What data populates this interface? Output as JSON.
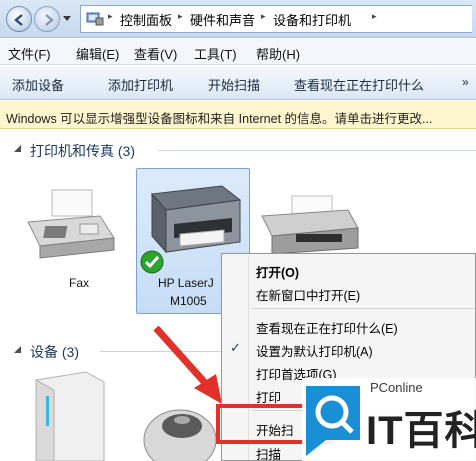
{
  "address_bar": {
    "breadcrumbs": [
      "控制面板",
      "硬件和声音",
      "设备和打印机"
    ],
    "separator": "▸"
  },
  "menu": {
    "items": [
      "文件(F)",
      "编辑(E)",
      "查看(V)",
      "工具(T)",
      "帮助(H)"
    ]
  },
  "commands": {
    "items": [
      "添加设备",
      "添加打印机",
      "开始扫描",
      "查看现在正在打印什么"
    ],
    "more": "»"
  },
  "info_bar": {
    "text": "Windows 可以显示增强型设备图标和来自 Internet 的信息。请单击进行更改..."
  },
  "groups": {
    "printers": {
      "title": "打印机和传真 (3)",
      "devices": [
        {
          "label": "Fax"
        },
        {
          "label_line1": "HP LaserJ",
          "label_line2": "M1005"
        }
      ]
    },
    "devices": {
      "title": "设备 (3)"
    }
  },
  "context_menu": {
    "items": [
      {
        "label": "打开(O)",
        "bold": true
      },
      {
        "label": "在新窗口中打开(E)"
      },
      {
        "label": "查看现在正在打印什么(E)"
      },
      {
        "label": "设置为默认打印机(A)",
        "checked": true
      },
      {
        "label": "打印首选项(G)"
      },
      {
        "label": "打印"
      },
      {
        "label": "开始扫"
      },
      {
        "label": "扫描"
      }
    ],
    "check_glyph": "✓"
  },
  "watermark": {
    "brand_small": "PConline",
    "brand_big": "IT百科"
  },
  "colors": {
    "accent": "#1e3b61",
    "selection": "#c6ddf6",
    "annotation_red": "#e0312b",
    "watermark_blue": "#1a8fd6"
  }
}
